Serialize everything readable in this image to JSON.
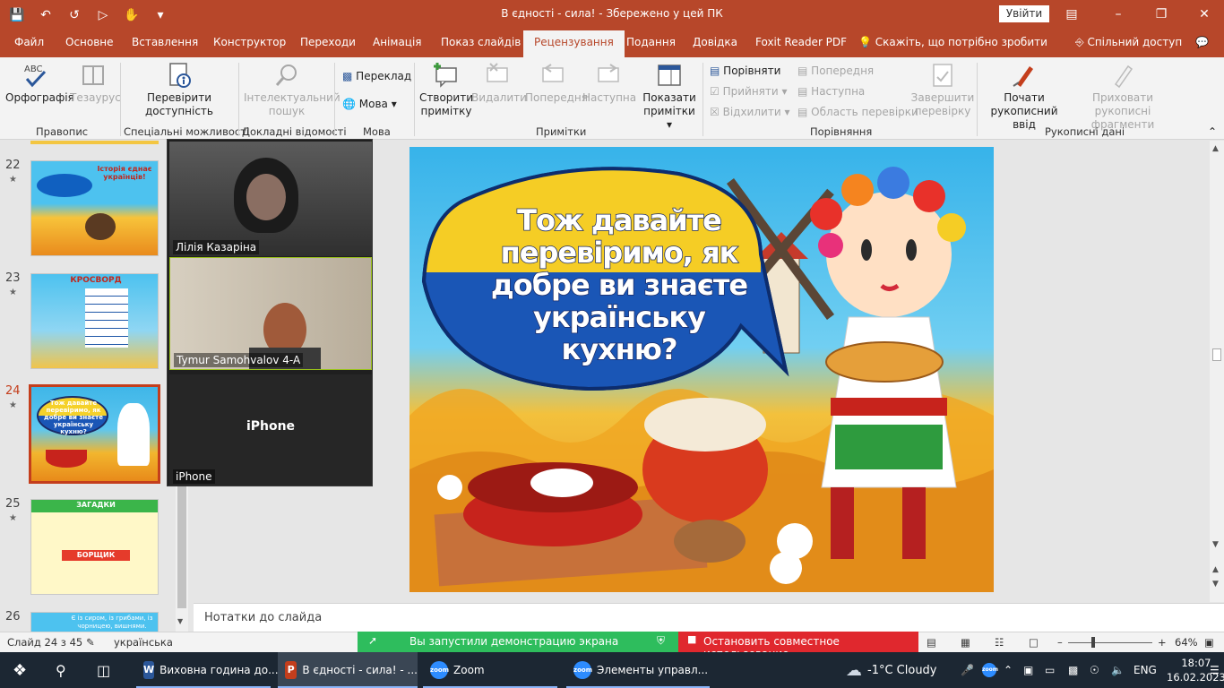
{
  "window": {
    "title": "В єдності - сила!  -  Збережено у цей ПК",
    "signin": "Увійти"
  },
  "tabs": [
    "Файл",
    "Основне",
    "Вставлення",
    "Конструктор",
    "Переходи",
    "Анімація",
    "Показ слайдів",
    "Рецензування",
    "Подання",
    "Довідка",
    "Foxit Reader PDF",
    "Скажіть, що потрібно зробити",
    "Спільний доступ"
  ],
  "ribbon": {
    "spelling": "Орфографія",
    "thesaurus": "Тезаурус",
    "group_proofing": "Правопис",
    "check_access_1": "Перевірити",
    "check_access_2": "доступність",
    "group_access": "Спеціальні можливості",
    "smart_lookup_1": "Інтелектуальний",
    "smart_lookup_2": "пошук",
    "group_insights": "Докладні відомості",
    "translate": "Переклад",
    "language": "Мова",
    "group_language": "Мова",
    "new_comment_1": "Створити",
    "new_comment_2": "примітку",
    "delete": "Видалити",
    "previous": "Попередня",
    "next": "Наступна",
    "show_comments_1": "Показати",
    "show_comments_2": "примітки",
    "group_comments": "Примітки",
    "compare": "Порівняти",
    "accept": "Прийняти",
    "reject": "Відхилити",
    "prev2": "Попередня",
    "next2": "Наступна",
    "reviewing_pane": "Область перевірки",
    "end_review_1": "Завершити",
    "end_review_2": "перевірку",
    "group_compare": "Порівняння",
    "start_inking_1": "Почати",
    "start_inking_2": "рукописний ввід",
    "hide_ink_1": "Приховати рукописні",
    "hide_ink_2": "фрагменти",
    "group_ink": "Рукописні дані"
  },
  "thumbnails": [
    {
      "num": "22",
      "title": "Історія єднає українців!"
    },
    {
      "num": "23",
      "title": "КРОСВОРД"
    },
    {
      "num": "24",
      "title": "Тож давайте перевіримо, як добре ви знаєте українську кухню?"
    },
    {
      "num": "25",
      "title": "ЗАГАДКИ",
      "sub": "БОРЩИК"
    },
    {
      "num": "26",
      "title": "Є із сиром, із грибами, із чорницею, вишнями."
    }
  ],
  "zoom": {
    "p1": "Лілія Казаріна",
    "p2": "Tymur Samohvalov 4-A",
    "p3_center": "iPhone",
    "p3_label": "iPhone"
  },
  "slide": {
    "bubble_text": "Тож давайте перевіримо, як добре ви знаєте українську кухню?"
  },
  "notes": "Нотатки до слайда",
  "status": {
    "slide_of": "Слайд 24 з 45",
    "language": "українська",
    "share_started": "Вы запустили демонстрацию экрана",
    "stop_share": "Остановить совместное использование",
    "zoom_level": "64%"
  },
  "taskbar": {
    "items": [
      "Виховна година до...",
      "В єдності - сила! - ...",
      "Zoom",
      "Элементы управл..."
    ],
    "weather": "-1°C  Cloudy",
    "lang": "ENG",
    "time": "18:07",
    "date": "16.02.2023"
  }
}
